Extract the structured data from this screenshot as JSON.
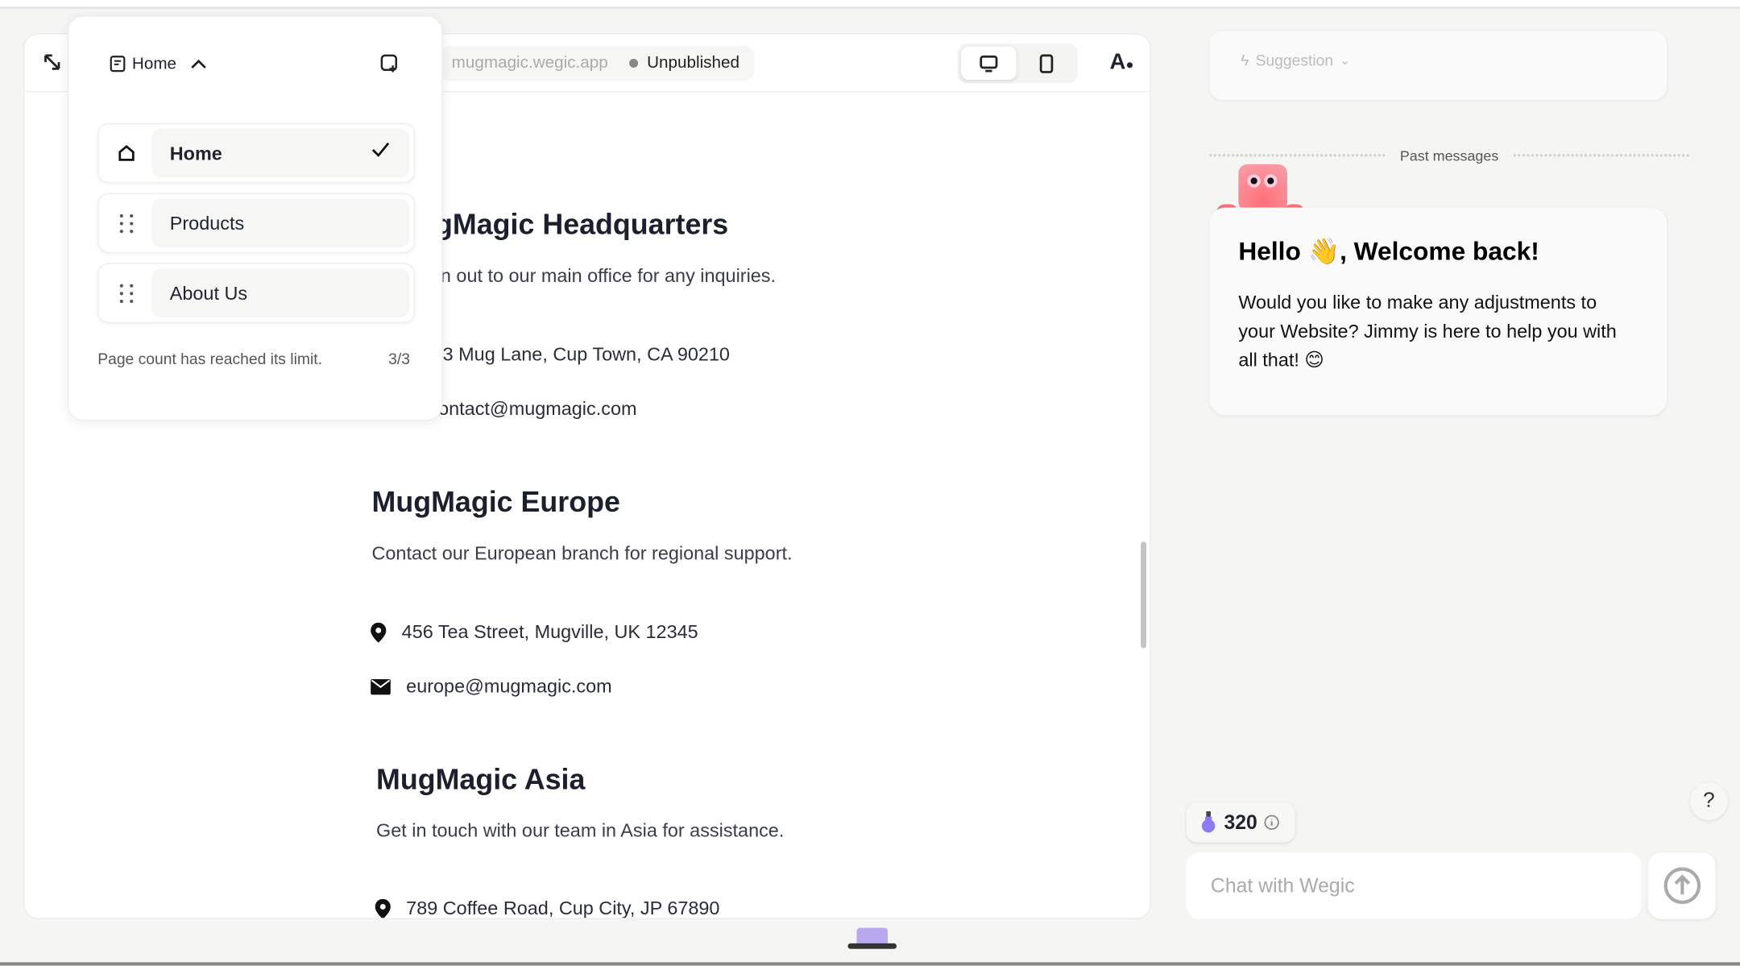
{
  "toolbar": {
    "current_page": "Home",
    "url": "mugmagic.wegic.app",
    "status": "Unpublished",
    "icons": [
      "collapse-icon",
      "page-icon",
      "chevron-up-icon",
      "add-page-icon",
      "desktop-icon",
      "mobile-icon",
      "font-style-icon"
    ]
  },
  "page_menu": {
    "pages": [
      {
        "label": "Home",
        "icon": "home-icon",
        "selected": true
      },
      {
        "label": "Products",
        "icon": "drag-handle-icon",
        "selected": false
      },
      {
        "label": "About Us",
        "icon": "drag-handle-icon",
        "selected": false
      }
    ],
    "limit_text": "Page count has reached its limit.",
    "count": "3/3"
  },
  "site": {
    "sections": [
      {
        "title": "gMagic Headquarters",
        "desc": "n out to our main office for any inquiries.",
        "address": "3 Mug Lane, Cup Town, CA 90210",
        "email": "ontact@mugmagic.com"
      },
      {
        "title": "MugMagic Europe",
        "desc": "Contact our European branch for regional support.",
        "address": "456 Tea Street, Mugville, UK 12345",
        "email": "europe@mugmagic.com"
      },
      {
        "title": "MugMagic Asia",
        "desc": "Get in touch with our team in Asia for assistance.",
        "address": "789 Coffee Road, Cup City, JP 67890"
      }
    ]
  },
  "chat": {
    "suggestion": "Suggestion",
    "past_messages": "Past messages",
    "greeting_title_pre": "Hello ",
    "greeting_emoji": "👋",
    "greeting_title_post": ", Welcome back!",
    "greeting_body": "Would you like to make any adjustments to your Website? Jimmy is here to help you with all that! ",
    "greeting_body_emoji": "😊",
    "credits": "320",
    "help": "?",
    "input_placeholder": "Chat with Wegic"
  },
  "colors": {
    "accent_mascot": "#f4606a",
    "credit_potion": "#8b7cf6"
  }
}
